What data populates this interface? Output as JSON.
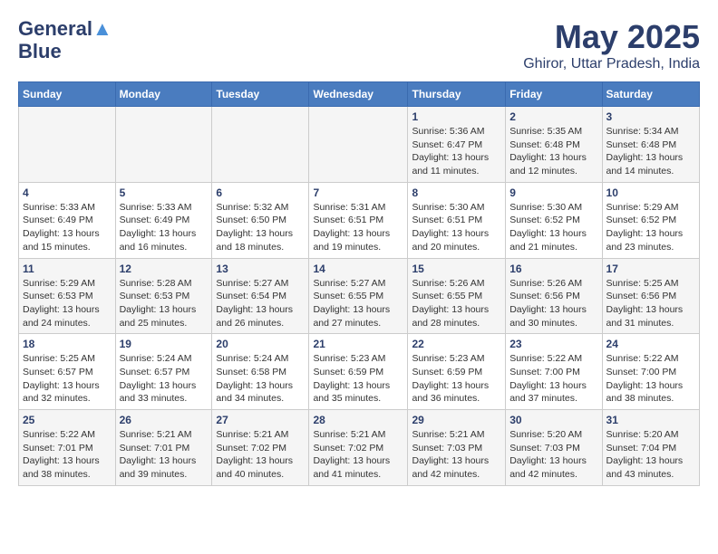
{
  "header": {
    "logo_line1": "General",
    "logo_line2": "Blue",
    "month_year": "May 2025",
    "location": "Ghiror, Uttar Pradesh, India"
  },
  "days_of_week": [
    "Sunday",
    "Monday",
    "Tuesday",
    "Wednesday",
    "Thursday",
    "Friday",
    "Saturday"
  ],
  "weeks": [
    [
      {
        "day": "",
        "info": ""
      },
      {
        "day": "",
        "info": ""
      },
      {
        "day": "",
        "info": ""
      },
      {
        "day": "",
        "info": ""
      },
      {
        "day": "1",
        "info": "Sunrise: 5:36 AM\nSunset: 6:47 PM\nDaylight: 13 hours\nand 11 minutes."
      },
      {
        "day": "2",
        "info": "Sunrise: 5:35 AM\nSunset: 6:48 PM\nDaylight: 13 hours\nand 12 minutes."
      },
      {
        "day": "3",
        "info": "Sunrise: 5:34 AM\nSunset: 6:48 PM\nDaylight: 13 hours\nand 14 minutes."
      }
    ],
    [
      {
        "day": "4",
        "info": "Sunrise: 5:33 AM\nSunset: 6:49 PM\nDaylight: 13 hours\nand 15 minutes."
      },
      {
        "day": "5",
        "info": "Sunrise: 5:33 AM\nSunset: 6:49 PM\nDaylight: 13 hours\nand 16 minutes."
      },
      {
        "day": "6",
        "info": "Sunrise: 5:32 AM\nSunset: 6:50 PM\nDaylight: 13 hours\nand 18 minutes."
      },
      {
        "day": "7",
        "info": "Sunrise: 5:31 AM\nSunset: 6:51 PM\nDaylight: 13 hours\nand 19 minutes."
      },
      {
        "day": "8",
        "info": "Sunrise: 5:30 AM\nSunset: 6:51 PM\nDaylight: 13 hours\nand 20 minutes."
      },
      {
        "day": "9",
        "info": "Sunrise: 5:30 AM\nSunset: 6:52 PM\nDaylight: 13 hours\nand 21 minutes."
      },
      {
        "day": "10",
        "info": "Sunrise: 5:29 AM\nSunset: 6:52 PM\nDaylight: 13 hours\nand 23 minutes."
      }
    ],
    [
      {
        "day": "11",
        "info": "Sunrise: 5:29 AM\nSunset: 6:53 PM\nDaylight: 13 hours\nand 24 minutes."
      },
      {
        "day": "12",
        "info": "Sunrise: 5:28 AM\nSunset: 6:53 PM\nDaylight: 13 hours\nand 25 minutes."
      },
      {
        "day": "13",
        "info": "Sunrise: 5:27 AM\nSunset: 6:54 PM\nDaylight: 13 hours\nand 26 minutes."
      },
      {
        "day": "14",
        "info": "Sunrise: 5:27 AM\nSunset: 6:55 PM\nDaylight: 13 hours\nand 27 minutes."
      },
      {
        "day": "15",
        "info": "Sunrise: 5:26 AM\nSunset: 6:55 PM\nDaylight: 13 hours\nand 28 minutes."
      },
      {
        "day": "16",
        "info": "Sunrise: 5:26 AM\nSunset: 6:56 PM\nDaylight: 13 hours\nand 30 minutes."
      },
      {
        "day": "17",
        "info": "Sunrise: 5:25 AM\nSunset: 6:56 PM\nDaylight: 13 hours\nand 31 minutes."
      }
    ],
    [
      {
        "day": "18",
        "info": "Sunrise: 5:25 AM\nSunset: 6:57 PM\nDaylight: 13 hours\nand 32 minutes."
      },
      {
        "day": "19",
        "info": "Sunrise: 5:24 AM\nSunset: 6:57 PM\nDaylight: 13 hours\nand 33 minutes."
      },
      {
        "day": "20",
        "info": "Sunrise: 5:24 AM\nSunset: 6:58 PM\nDaylight: 13 hours\nand 34 minutes."
      },
      {
        "day": "21",
        "info": "Sunrise: 5:23 AM\nSunset: 6:59 PM\nDaylight: 13 hours\nand 35 minutes."
      },
      {
        "day": "22",
        "info": "Sunrise: 5:23 AM\nSunset: 6:59 PM\nDaylight: 13 hours\nand 36 minutes."
      },
      {
        "day": "23",
        "info": "Sunrise: 5:22 AM\nSunset: 7:00 PM\nDaylight: 13 hours\nand 37 minutes."
      },
      {
        "day": "24",
        "info": "Sunrise: 5:22 AM\nSunset: 7:00 PM\nDaylight: 13 hours\nand 38 minutes."
      }
    ],
    [
      {
        "day": "25",
        "info": "Sunrise: 5:22 AM\nSunset: 7:01 PM\nDaylight: 13 hours\nand 38 minutes."
      },
      {
        "day": "26",
        "info": "Sunrise: 5:21 AM\nSunset: 7:01 PM\nDaylight: 13 hours\nand 39 minutes."
      },
      {
        "day": "27",
        "info": "Sunrise: 5:21 AM\nSunset: 7:02 PM\nDaylight: 13 hours\nand 40 minutes."
      },
      {
        "day": "28",
        "info": "Sunrise: 5:21 AM\nSunset: 7:02 PM\nDaylight: 13 hours\nand 41 minutes."
      },
      {
        "day": "29",
        "info": "Sunrise: 5:21 AM\nSunset: 7:03 PM\nDaylight: 13 hours\nand 42 minutes."
      },
      {
        "day": "30",
        "info": "Sunrise: 5:20 AM\nSunset: 7:03 PM\nDaylight: 13 hours\nand 42 minutes."
      },
      {
        "day": "31",
        "info": "Sunrise: 5:20 AM\nSunset: 7:04 PM\nDaylight: 13 hours\nand 43 minutes."
      }
    ]
  ]
}
